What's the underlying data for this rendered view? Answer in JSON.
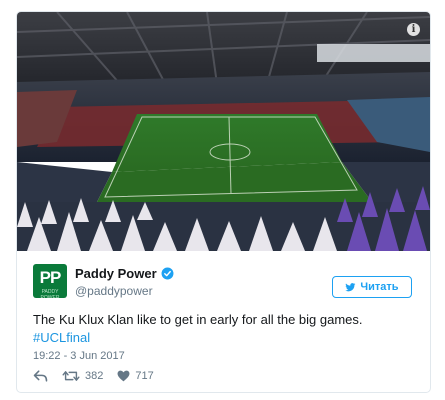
{
  "media": {
    "alt_scene": "stadium interior photo",
    "info_symbol": "i"
  },
  "account": {
    "avatar_text": "PP",
    "avatar_subtext": "PADDY POWER",
    "display_name": "Paddy Power",
    "handle": "@paddypower",
    "verified": true
  },
  "follow_button": {
    "label": "Читать",
    "icon": "twitter-bird-icon"
  },
  "tweet": {
    "text": "The Ku Klux Klan like to get in early for all the big games.",
    "hashtag": "#UCLfinal",
    "timestamp": "19:22 - 3 Jun 2017"
  },
  "actions": {
    "reply_icon": "reply-icon",
    "retweet_icon": "retweet-icon",
    "retweet_count": "382",
    "like_icon": "heart-icon",
    "like_count": "717"
  },
  "colors": {
    "accent": "#1da1f2",
    "hashtag": "#1b95e0",
    "muted": "#657786",
    "brand_green": "#0a7a3a"
  }
}
